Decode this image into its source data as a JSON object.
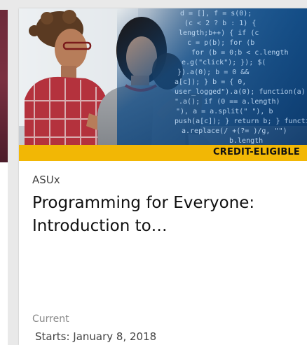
{
  "course_card": {
    "badge": "CREDIT-ELIGIBLE",
    "org": "ASUx",
    "title": "Programming for Everyone: Introduction to…",
    "status": "Current",
    "start_date": "Starts: January 8, 2018",
    "image_alt": "Students looking at a laptop with code overlay",
    "colors": {
      "badge": "#f2b705",
      "card": "#ffffff",
      "background": "#e9e9e9"
    }
  }
}
